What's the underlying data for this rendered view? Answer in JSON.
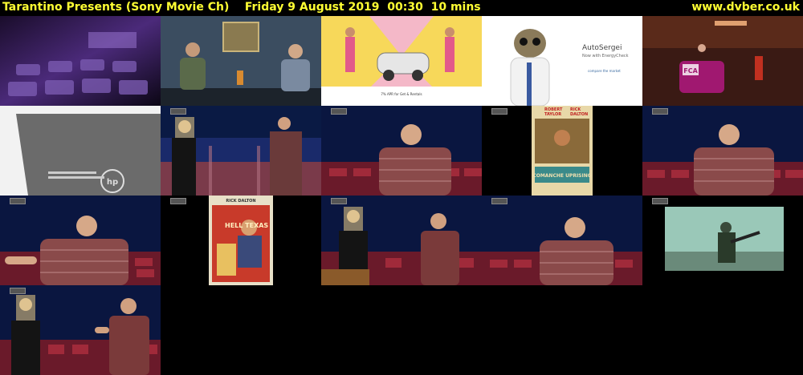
{
  "header": {
    "title": "Tarantino Presents (Sony Movie Ch)    Friday 9 August 2019  00:30  10 mins",
    "site": "www.dvber.co.uk"
  },
  "thumbnails": {
    "t3": {
      "caption": "7% APR for Get & Rentals",
      "logo": ""
    },
    "t4": {
      "brand": "AutoSergei",
      "subtitle": "Now with EnergyCheck",
      "logo": "compare the market"
    },
    "t5": {
      "logo": "FCA"
    },
    "t6": {
      "text": "hp"
    },
    "t9": {
      "top1": "ROBERT",
      "top2": "RICK",
      "top3": "TAYLOR",
      "top4": "DALTON",
      "title": "COMANCHE UPRISING"
    },
    "t12": {
      "top": "RICK DALTON",
      "title": "HELL TEXAS"
    }
  }
}
